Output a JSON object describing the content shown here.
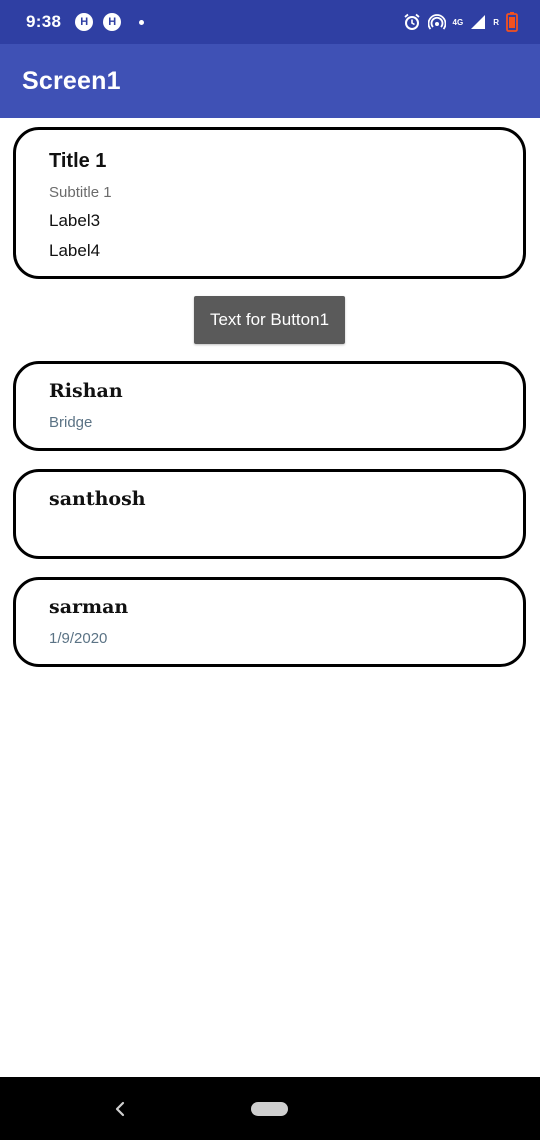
{
  "status_bar": {
    "time": "9:38",
    "left_badges": [
      "H",
      "H"
    ],
    "network_label": "4G",
    "roaming_label": "R",
    "colors": {
      "background": "#2f3fa3",
      "battery_alert": "#f4511e"
    },
    "icons": [
      "alarm-icon",
      "hotspot-icon",
      "signal-icon",
      "battery-icon"
    ]
  },
  "app_bar": {
    "title": "Screen1",
    "color": "#3f51b5"
  },
  "card_main": {
    "title": "Title 1",
    "subtitle": "Subtitle 1",
    "label3": "Label3",
    "label4": "Label4"
  },
  "button": {
    "label": "Text for Button1",
    "color": "#5a5a5a"
  },
  "list": [
    {
      "name": "Rishan",
      "detail": "Bridge"
    },
    {
      "name": "santhosh",
      "detail": ""
    },
    {
      "name": "sarman",
      "detail": "1/9/2020"
    }
  ],
  "nav_bar": {
    "icons": [
      "back-icon",
      "home-pill-icon"
    ]
  }
}
